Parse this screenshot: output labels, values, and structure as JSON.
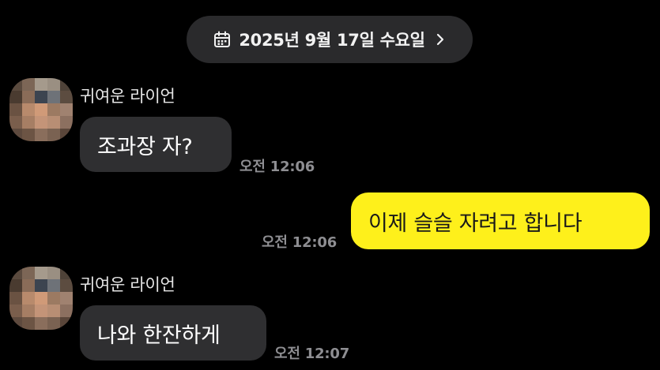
{
  "date_header": {
    "label": "2025년 9월 17일 수요일",
    "icon": "calendar-icon",
    "chevron": "chevron-right-icon"
  },
  "messages": [
    {
      "direction": "incoming",
      "sender": "귀여운 라이언",
      "avatar": "pixelated-avatar",
      "text": "조과장 자?",
      "time": "오전 12:06"
    },
    {
      "direction": "outgoing",
      "text": "이제 슬슬 자려고 합니다",
      "time": "오전 12:06"
    },
    {
      "direction": "incoming",
      "sender": "귀여운 라이언",
      "avatar": "pixelated-avatar",
      "text": "나와 한잔하게",
      "time": "오전 12:07"
    }
  ],
  "colors": {
    "background": "#000000",
    "incoming_bubble": "#2f2f31",
    "outgoing_bubble": "#fef01b",
    "timestamp": "#8e8e92",
    "date_pill": "#2a2a2c"
  }
}
